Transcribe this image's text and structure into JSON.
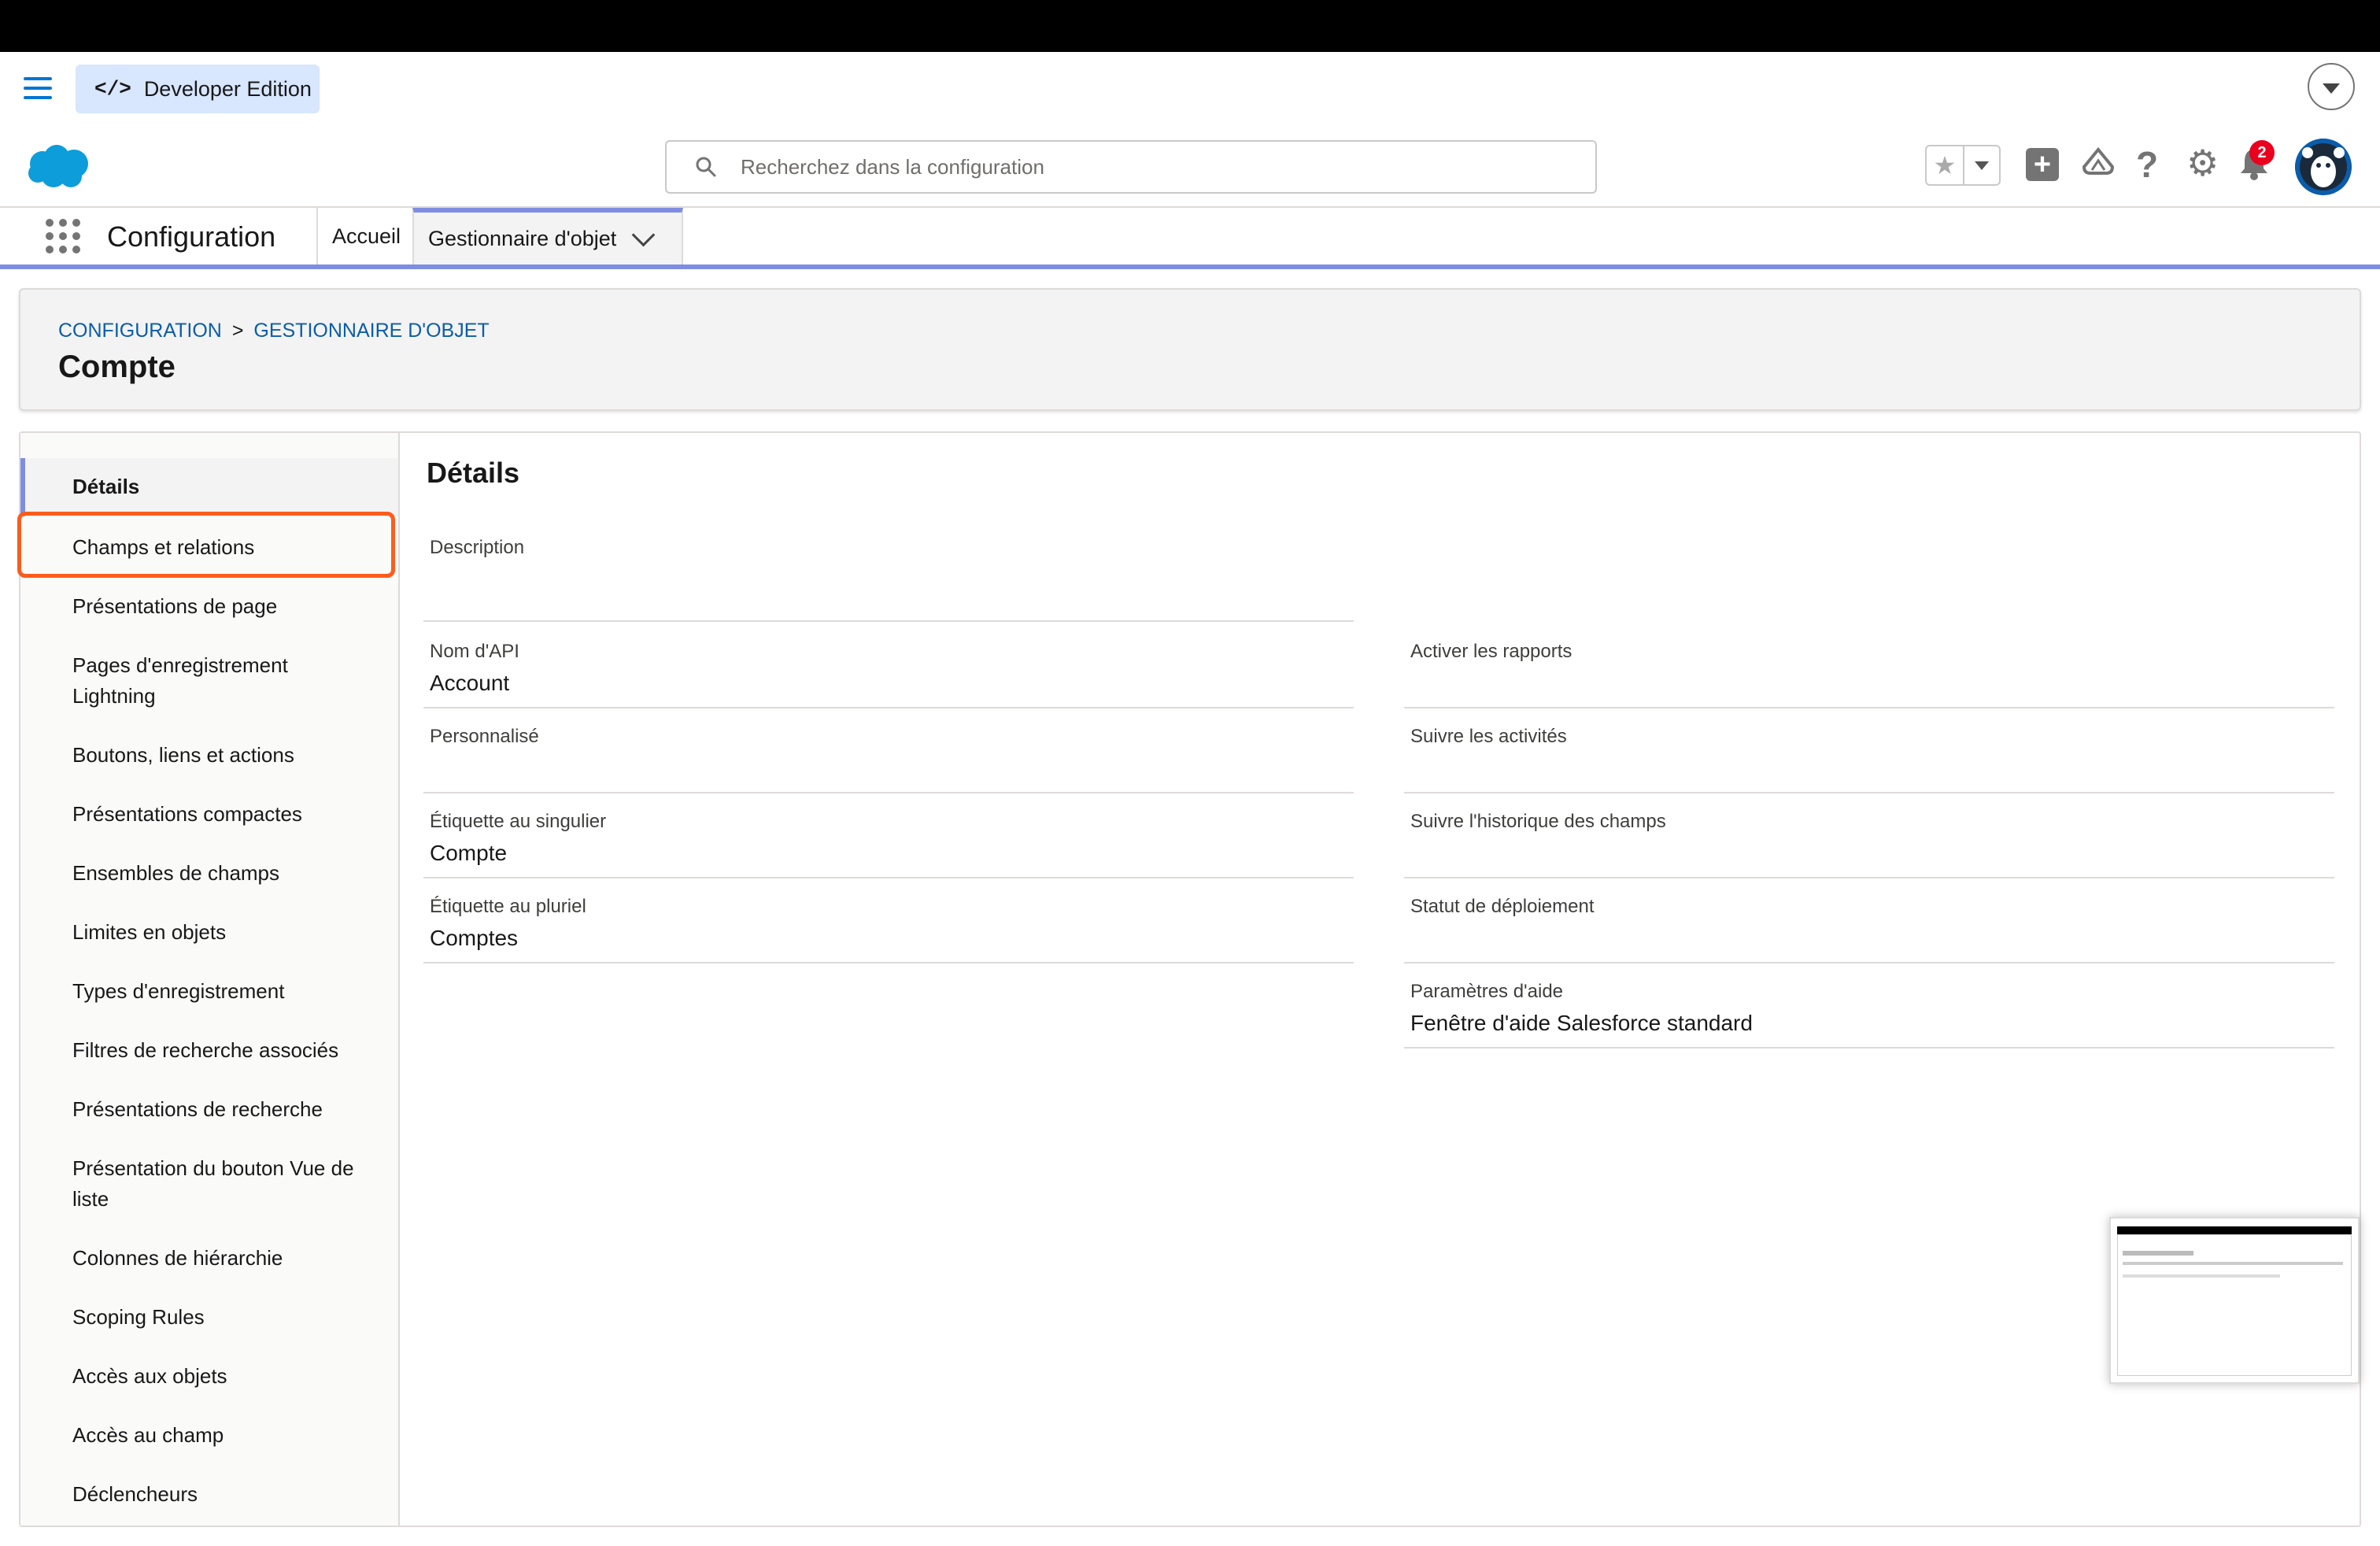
{
  "dev_bar": {
    "edition_label": "Developer Edition",
    "code_glyph": "</>"
  },
  "search": {
    "placeholder": "Recherchez dans la configuration"
  },
  "header": {
    "notification_count": "2"
  },
  "app": {
    "name": "Configuration",
    "tabs": [
      {
        "label": "Accueil"
      },
      {
        "label": "Gestionnaire d'objet"
      }
    ]
  },
  "page": {
    "breadcrumb": [
      "CONFIGURATION",
      "GESTIONNAIRE D'OBJET"
    ],
    "breadcrumb_separator": ">",
    "title": "Compte"
  },
  "sidebar": {
    "items": [
      {
        "label": "Détails"
      },
      {
        "label": "Champs et relations"
      },
      {
        "label": "Présentations de page"
      },
      {
        "label": "Pages d'enregistrement Lightning"
      },
      {
        "label": "Boutons, liens et actions"
      },
      {
        "label": "Présentations compactes"
      },
      {
        "label": "Ensembles de champs"
      },
      {
        "label": "Limites en objets"
      },
      {
        "label": "Types d'enregistrement"
      },
      {
        "label": "Filtres de recherche associés"
      },
      {
        "label": "Présentations de recherche"
      },
      {
        "label": "Présentation du bouton Vue de liste"
      },
      {
        "label": "Colonnes de hiérarchie"
      },
      {
        "label": "Scoping Rules"
      },
      {
        "label": "Accès aux objets"
      },
      {
        "label": "Accès au champ"
      },
      {
        "label": "Déclencheurs"
      }
    ]
  },
  "details": {
    "title": "Détails",
    "left": [
      {
        "label": "Description",
        "value": ""
      },
      {
        "label": "Nom d'API",
        "value": "Account"
      },
      {
        "label": "Personnalisé",
        "value": ""
      },
      {
        "label": "Étiquette au singulier",
        "value": "Compte"
      },
      {
        "label": "Étiquette au pluriel",
        "value": "Comptes"
      }
    ],
    "right": [
      {
        "label": "Activer les rapports",
        "value": ""
      },
      {
        "label": "Suivre les activités",
        "value": ""
      },
      {
        "label": "Suivre l'historique des champs",
        "value": ""
      },
      {
        "label": "Statut de déploiement",
        "value": ""
      },
      {
        "label": "Paramètres d'aide",
        "value": "Fenêtre d'aide Salesforce standard"
      }
    ]
  },
  "colors": {
    "brand": "#0176d3",
    "accent_tab": "#7f8de1",
    "highlight": "#fe5b1c",
    "badge": "#ea001e"
  }
}
